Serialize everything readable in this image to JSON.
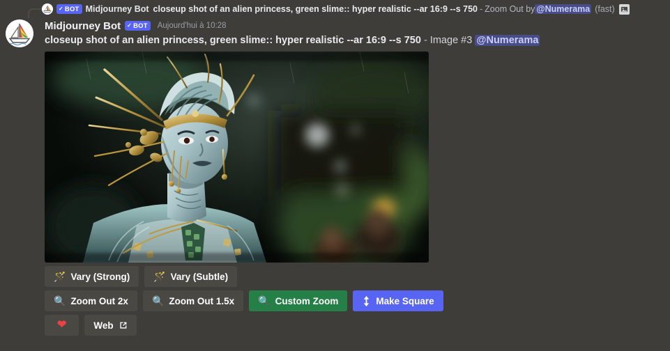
{
  "reply": {
    "avatar_icon": "sailboat-avatar-icon",
    "bot_badge": {
      "check": "✓",
      "label": "BOT"
    },
    "author": "Midjourney Bot",
    "prompt": "closeup shot of an alien princess, green slime:: hyper realistic --ar 16:9 --s 750",
    "separator": "-",
    "action": "Zoom Out by",
    "mention": "@Numerama",
    "speed": "(fast)",
    "attachment_icon": "image-attachment-icon"
  },
  "message": {
    "avatar_icon": "sailboat-avatar-icon",
    "author": "Midjourney Bot",
    "bot_badge": {
      "check": "✓",
      "label": "BOT"
    },
    "timestamp": "Aujourd'hui à 10:28",
    "prompt": "closeup shot of an alien princess, green slime:: hyper realistic --ar 16:9 --s 750",
    "separator": "-",
    "image_label": "Image #3",
    "mention": "@Numerama",
    "image_alt": "alien princess with teal skin and ornate gold headdress, blurred green background"
  },
  "buttons": {
    "rows": [
      [
        {
          "name": "vary-strong-button",
          "label": "Vary (Strong)",
          "style": "secondary",
          "icon": "magic-wand-icon",
          "glyph": "🪄"
        },
        {
          "name": "vary-subtle-button",
          "label": "Vary (Subtle)",
          "style": "secondary",
          "icon": "magic-wand-icon",
          "glyph": "🪄"
        }
      ],
      [
        {
          "name": "zoom-out-2x-button",
          "label": "Zoom Out 2x",
          "style": "secondary",
          "icon": "magnifier-icon",
          "glyph": "🔍"
        },
        {
          "name": "zoom-out-1-5x-button",
          "label": "Zoom Out 1.5x",
          "style": "secondary",
          "icon": "magnifier-icon",
          "glyph": "🔍"
        },
        {
          "name": "custom-zoom-button",
          "label": "Custom Zoom",
          "style": "success",
          "icon": "magnifier-icon",
          "glyph": "🔍"
        },
        {
          "name": "make-square-button",
          "label": "Make Square",
          "style": "primary",
          "icon": "up-down-arrow-icon",
          "glyph": "↕"
        }
      ],
      [
        {
          "name": "favorite-button",
          "label": "",
          "style": "secondary",
          "icon": "heart-icon",
          "glyph": "❤"
        },
        {
          "name": "web-button",
          "label": "Web",
          "style": "secondary",
          "icon": "external-link-icon",
          "glyph": ""
        }
      ]
    ]
  },
  "colors": {
    "background": "#3f3d39",
    "button_secondary": "#4a4843",
    "button_success": "#248046",
    "button_primary": "#5865f2",
    "mention": "#5865f2",
    "heart": "#ed4245"
  }
}
